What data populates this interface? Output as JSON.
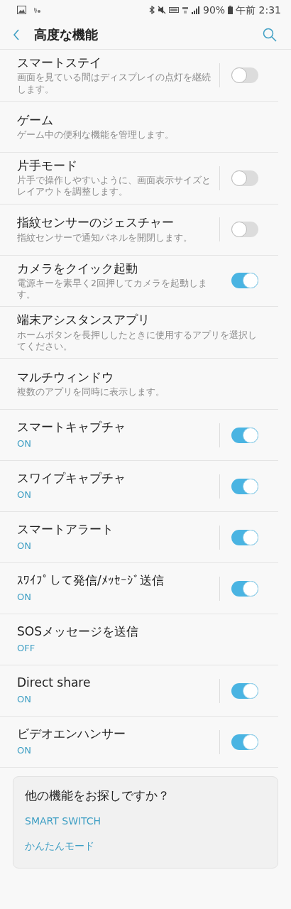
{
  "status_bar": {
    "battery": "90%",
    "time": "午前 2:31"
  },
  "app_bar": {
    "title": "高度な機能"
  },
  "items": [
    {
      "title": "スマートステイ",
      "summary": "画面を見ている間はディスプレイの点灯を継続します。",
      "on": false,
      "divider": true
    },
    {
      "title": "ゲーム",
      "summary": "ゲーム中の便利な機能を管理します。"
    },
    {
      "title": "片手モード",
      "summary": "片手で操作しやすいように、画面表示サイズとレイアウトを調整します。",
      "on": false,
      "divider": true
    },
    {
      "title": "指紋センサーのジェスチャー",
      "summary": "指紋センサーで通知パネルを開閉します。",
      "on": false,
      "divider": true
    },
    {
      "title": "カメラをクイック起動",
      "summary": "電源キーを素早く2回押してカメラを起動します。",
      "on": true
    },
    {
      "title": "端末アシスタンスアプリ",
      "summary": "ホームボタンを長押ししたときに使用するアプリを選択してください。"
    },
    {
      "title": "マルチウィンドウ",
      "summary": "複数のアプリを同時に表示します。"
    },
    {
      "title": "スマートキャプチャ",
      "status": "ON",
      "on": true,
      "divider": true
    },
    {
      "title": "スワイプキャプチャ",
      "status": "ON",
      "on": true,
      "divider": true
    },
    {
      "title": "スマートアラート",
      "status": "ON",
      "on": true,
      "divider": true
    },
    {
      "title": "ｽﾜｲﾌﾟして発信/ﾒｯｾｰｼﾞ送信",
      "status": "ON",
      "on": true,
      "divider": true
    },
    {
      "title": "SOSメッセージを送信",
      "status": "OFF"
    },
    {
      "title": "Direct share",
      "status": "ON",
      "on": true,
      "divider": true
    },
    {
      "title": "ビデオエンハンサー",
      "status": "ON",
      "on": true,
      "divider": true
    }
  ],
  "suggest_card": {
    "title": "他の機能をお探しですか？",
    "links": [
      "SMART SWITCH",
      "かんたんモード"
    ]
  }
}
